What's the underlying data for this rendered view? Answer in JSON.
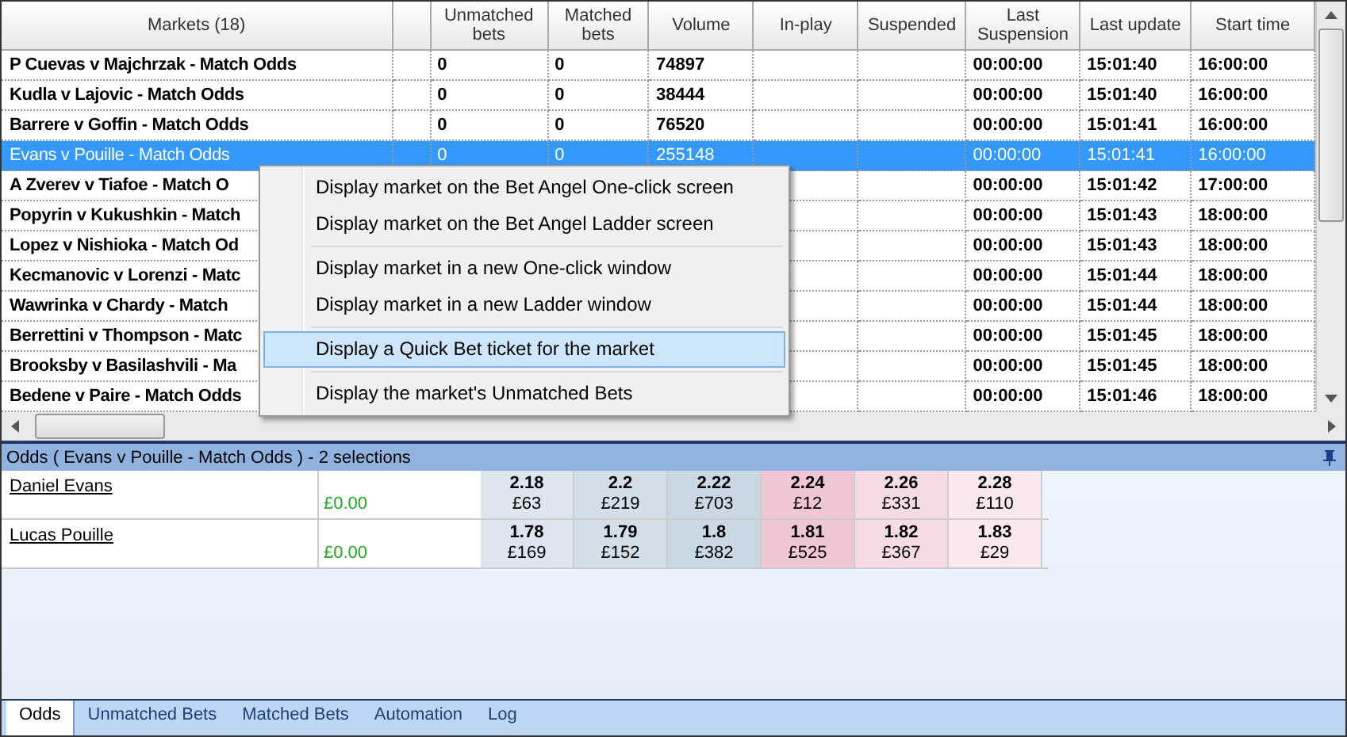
{
  "markets": {
    "columns": [
      {
        "label": "Markets (18)"
      },
      {},
      {
        "label": "Unmatched bets"
      },
      {
        "label": "Matched bets"
      },
      {
        "label": "Volume"
      },
      {
        "label": "In-play"
      },
      {
        "label": "Suspended"
      },
      {
        "label": "Last Suspension"
      },
      {
        "label": "Last update"
      },
      {
        "label": "Start time"
      }
    ],
    "rows": [
      {
        "market": "P Cuevas v Majchrzak - Match Odds",
        "unmatched": "0",
        "matched": "0",
        "volume": "74897",
        "last_suspension": "00:00:00",
        "last_update": "15:01:40",
        "start_time": "16:00:00",
        "selected": false
      },
      {
        "market": "Kudla v Lajovic - Match Odds",
        "unmatched": "0",
        "matched": "0",
        "volume": "38444",
        "last_suspension": "00:00:00",
        "last_update": "15:01:40",
        "start_time": "16:00:00",
        "selected": false
      },
      {
        "market": "Barrere v Goffin - Match Odds",
        "unmatched": "0",
        "matched": "0",
        "volume": "76520",
        "last_suspension": "00:00:00",
        "last_update": "15:01:41",
        "start_time": "16:00:00",
        "selected": false
      },
      {
        "market": "Evans v Pouille - Match Odds",
        "unmatched": "0",
        "matched": "0",
        "volume": "255148",
        "last_suspension": "00:00:00",
        "last_update": "15:01:41",
        "start_time": "16:00:00",
        "selected": true
      },
      {
        "market": "A Zverev v Tiafoe - Match O",
        "last_suspension": "00:00:00",
        "last_update": "15:01:42",
        "start_time": "17:00:00",
        "selected": false
      },
      {
        "market": "Popyrin v Kukushkin - Match",
        "last_suspension": "00:00:00",
        "last_update": "15:01:43",
        "start_time": "18:00:00",
        "selected": false
      },
      {
        "market": "Lopez v Nishioka - Match Od",
        "last_suspension": "00:00:00",
        "last_update": "15:01:43",
        "start_time": "18:00:00",
        "selected": false
      },
      {
        "market": "Kecmanovic v Lorenzi - Matc",
        "last_suspension": "00:00:00",
        "last_update": "15:01:44",
        "start_time": "18:00:00",
        "selected": false
      },
      {
        "market": "Wawrinka v Chardy - Match",
        "last_suspension": "00:00:00",
        "last_update": "15:01:44",
        "start_time": "18:00:00",
        "selected": false
      },
      {
        "market": "Berrettini v Thompson - Matc",
        "last_suspension": "00:00:00",
        "last_update": "15:01:45",
        "start_time": "18:00:00",
        "selected": false
      },
      {
        "market": "Brooksby v Basilashvili - Ma",
        "last_suspension": "00:00:00",
        "last_update": "15:01:45",
        "start_time": "18:00:00",
        "selected": false
      },
      {
        "market": "Bedene v Paire - Match Odds",
        "last_suspension": "00:00:00",
        "last_update": "15:01:46",
        "start_time": "18:00:00",
        "selected": false
      }
    ]
  },
  "context_menu": {
    "groups": [
      [
        {
          "label": "Display market on the Bet Angel One-click screen",
          "selected": false
        },
        {
          "label": "Display market on the Bet Angel Ladder screen",
          "selected": false
        }
      ],
      [
        {
          "label": "Display market in a new One-click window",
          "selected": false
        },
        {
          "label": "Display market in a new Ladder window",
          "selected": false
        }
      ],
      [
        {
          "label": "Display a Quick Bet ticket for the market",
          "selected": true
        }
      ],
      [
        {
          "label": "Display the market's Unmatched Bets",
          "selected": false
        }
      ]
    ]
  },
  "odds_panel": {
    "title": "Odds ( Evans v Pouille - Match Odds ) - 2 selections",
    "selections": [
      {
        "name": "Daniel Evans",
        "profit": "£0.00",
        "prices": [
          {
            "price": "2.18",
            "amount": "£63",
            "color": "#dde6ee"
          },
          {
            "price": "2.2",
            "amount": "£219",
            "color": "#d3dfe8"
          },
          {
            "price": "2.22",
            "amount": "£703",
            "color": "#c8d9e4"
          },
          {
            "price": "2.24",
            "amount": "£12",
            "color": "#f0c6d6"
          },
          {
            "price": "2.26",
            "amount": "£331",
            "color": "#f6dbe5"
          },
          {
            "price": "2.28",
            "amount": "£110",
            "color": "#fae8ef"
          }
        ]
      },
      {
        "name": "Lucas Pouille",
        "profit": "£0.00",
        "prices": [
          {
            "price": "1.78",
            "amount": "£169",
            "color": "#dde6ee"
          },
          {
            "price": "1.79",
            "amount": "£152",
            "color": "#d3dfe8"
          },
          {
            "price": "1.8",
            "amount": "£382",
            "color": "#c8d9e4"
          },
          {
            "price": "1.81",
            "amount": "£525",
            "color": "#f0c6d6"
          },
          {
            "price": "1.82",
            "amount": "£367",
            "color": "#f6dbe5"
          },
          {
            "price": "1.83",
            "amount": "£29",
            "color": "#fae8ef"
          }
        ]
      }
    ]
  },
  "tabs": [
    {
      "label": "Odds",
      "selected": true
    },
    {
      "label": "Unmatched Bets",
      "selected": false
    },
    {
      "label": "Matched Bets",
      "selected": false
    },
    {
      "label": "Automation",
      "selected": false
    },
    {
      "label": "Log",
      "selected": false
    }
  ]
}
